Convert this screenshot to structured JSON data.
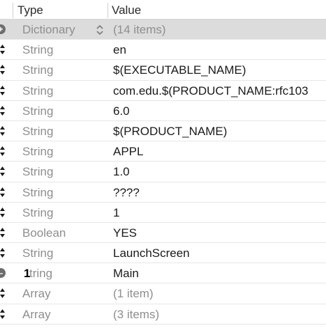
{
  "header": {
    "type_label": "Type",
    "value_label": "Value"
  },
  "rows": [
    {
      "type": "Dictionary",
      "value": "(14 items)",
      "control": "expand-button"
    },
    {
      "type": "String",
      "value": "en",
      "control": "stepper"
    },
    {
      "type": "String",
      "value": "$(EXECUTABLE_NAME)",
      "control": "stepper"
    },
    {
      "type": "String",
      "value": "com.edu.$(PRODUCT_NAME:rfc103",
      "control": "stepper"
    },
    {
      "type": "String",
      "value": "6.0",
      "control": "stepper"
    },
    {
      "type": "String",
      "value": "$(PRODUCT_NAME)",
      "control": "stepper"
    },
    {
      "type": "String",
      "value": "APPL",
      "control": "stepper"
    },
    {
      "type": "String",
      "value": "1.0",
      "control": "stepper"
    },
    {
      "type": "String",
      "value": "????",
      "control": "stepper"
    },
    {
      "type": "String",
      "value": "1",
      "control": "stepper"
    },
    {
      "type": "Boolean",
      "value": "YES",
      "control": "stepper"
    },
    {
      "type": "String",
      "value": "LaunchScreen",
      "control": "stepper"
    },
    {
      "type": "tring",
      "cursor_char": "1",
      "value": "Main",
      "control": "remove-button"
    },
    {
      "type": "Array",
      "value": "(1 item)",
      "control": "stepper"
    },
    {
      "type": "Array",
      "value": "(3 items)",
      "control": "stepper"
    }
  ],
  "colors": {
    "selected_row": "#dcdcdc",
    "type_text": "#8e8e8e",
    "value_text": "#1a1a1a"
  }
}
